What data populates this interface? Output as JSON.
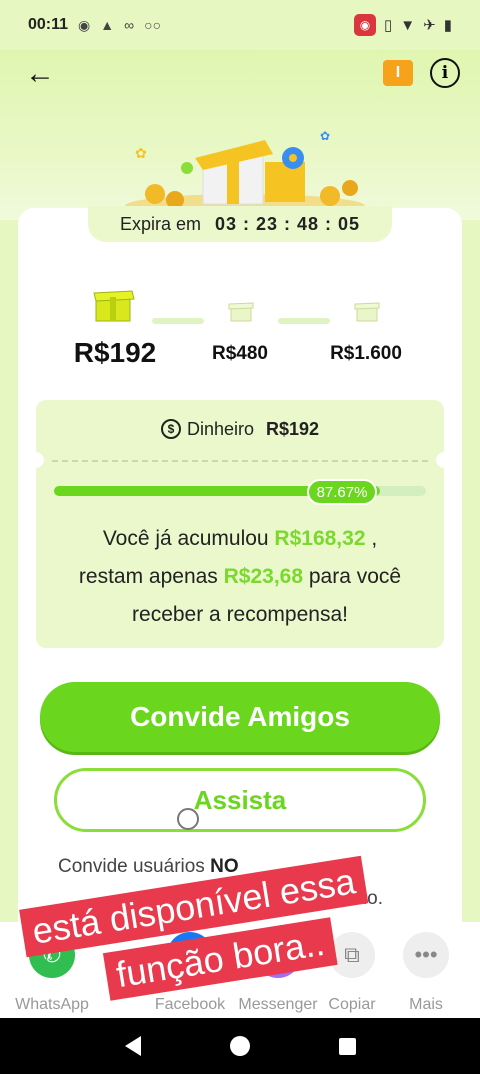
{
  "status_bar": {
    "time": "00:11",
    "left_icons": [
      "target-icon",
      "android-icon",
      "cast-icon",
      "voicemail-icon"
    ],
    "right_icons": [
      "record-icon",
      "vibrate-icon",
      "wifi-icon",
      "airplane-icon",
      "battery-icon"
    ]
  },
  "header": {
    "back_icon": "arrow-left-icon",
    "coupon_icon": "ticket-icon",
    "info_icon": "info-icon"
  },
  "expiry": {
    "label": "Expira em",
    "time": "03 : 23 : 48 : 05"
  },
  "tiers": [
    {
      "amount": "R$192",
      "active": true
    },
    {
      "amount": "R$480",
      "active": false
    },
    {
      "amount": "R$1.600",
      "active": false
    }
  ],
  "cash": {
    "label": "Dinheiro",
    "amount": "R$192"
  },
  "progress": {
    "percent_label": "87.67%",
    "fraction": 0.8767
  },
  "accumulation": {
    "part1": "Você já acumulou ",
    "accumulated": "R$168,32",
    "part2": " ,",
    "part3": "restam apenas ",
    "remaining": "R$23,68",
    "part4": " para você",
    "part5": "receber a recompensa!"
  },
  "buttons": {
    "invite": "Convide Amigos",
    "watch": "Assista"
  },
  "description": {
    "line1_start": "Convide usuários ",
    "line1_bold": "NO",
    "line2_end": "ado."
  },
  "share": [
    {
      "label": "WhatsApp",
      "icon": "whatsapp-icon"
    },
    {
      "label": "Facebook",
      "icon": "facebook-icon"
    },
    {
      "label": "Messenger",
      "icon": "messenger-icon"
    },
    {
      "label": "Copiar",
      "icon": "link-icon"
    },
    {
      "label": "Mais",
      "icon": "more-icon"
    }
  ],
  "overlay_caption": {
    "line1": "está disponível essa",
    "line2": "função bora.."
  },
  "colors": {
    "accent": "#6ad61e",
    "highlight": "#7ad92c",
    "caption_bg": "#e83a4c",
    "pale_green": "#eaf8cc"
  }
}
